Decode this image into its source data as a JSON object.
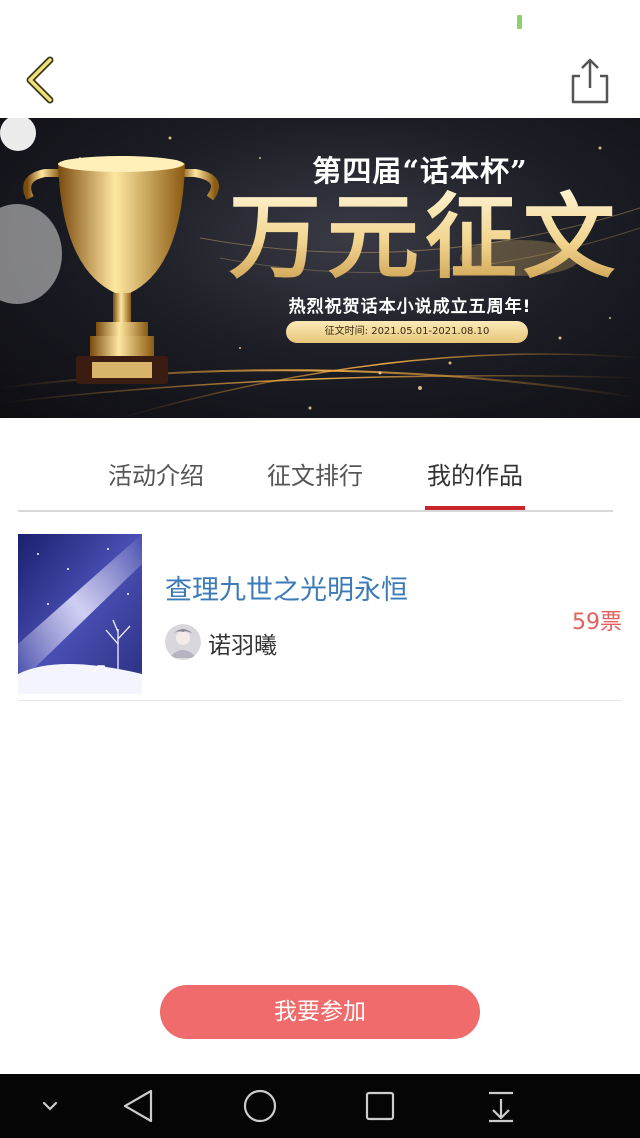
{
  "banner": {
    "subtitle": "第四届“话本杯”",
    "title": "万元征文",
    "tagline": "热烈祝贺话本小说成立五周年!",
    "date": "征文时间: 2021.05.01-2021.08.10"
  },
  "tabs": [
    {
      "label": "活动介绍",
      "active": false
    },
    {
      "label": "征文排行",
      "active": false
    },
    {
      "label": "我的作品",
      "active": true
    }
  ],
  "work": {
    "title": "查理九世之光明永恒",
    "author": "诺羽曦",
    "votes": "59票"
  },
  "join_label": "我要参加",
  "colors": {
    "accent_red": "#c8262c",
    "button_red": "#f06b6b",
    "title_blue": "#3d7ab8",
    "vote_red": "#e5605e"
  },
  "icons": {
    "back": "chevron-left-icon",
    "share": "share-icon",
    "nav": [
      "chevron-down-icon",
      "back-triangle-icon",
      "home-circle-icon",
      "recents-square-icon",
      "download-icon"
    ]
  }
}
